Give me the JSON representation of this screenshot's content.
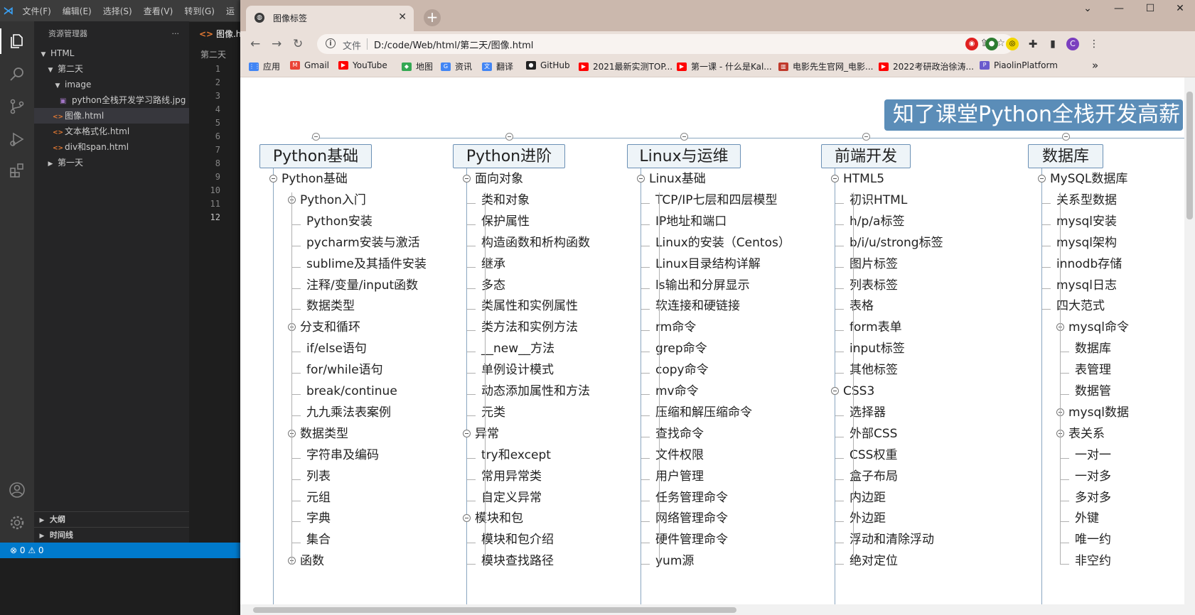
{
  "vscode": {
    "menu": [
      "文件(F)",
      "编辑(E)",
      "选择(S)",
      "查看(V)",
      "转到(G)",
      "运"
    ],
    "explorer_title": "资源管理器",
    "more": "···",
    "tree": [
      {
        "label": "HTML",
        "type": "folder-open",
        "indent": 0
      },
      {
        "label": "第二天",
        "type": "folder-open",
        "indent": 1
      },
      {
        "label": "image",
        "type": "folder-open",
        "indent": 2
      },
      {
        "label": "python全栈开发学习路线.jpg",
        "type": "image",
        "indent": 3
      },
      {
        "label": "图像.html",
        "type": "html",
        "indent": 2,
        "selected": true
      },
      {
        "label": "文本格式化.html",
        "type": "html",
        "indent": 2
      },
      {
        "label": "div和span.html",
        "type": "html",
        "indent": 2
      },
      {
        "label": "第一天",
        "type": "folder-closed",
        "indent": 1
      }
    ],
    "outline": "大纲",
    "timeline": "时间线",
    "tab": "图像.ht",
    "breadcrumb": "第二天",
    "line_numbers": [
      "1",
      "2",
      "3",
      "4",
      "5",
      "6",
      "7",
      "8",
      "9",
      "10",
      "11",
      "12"
    ],
    "current_line": "12",
    "status": "⊗ 0 ⚠ 0"
  },
  "browser": {
    "tab_title": "图像标签",
    "tab_close": "✕",
    "new_tab": "+",
    "window_controls": [
      "⌄",
      "—",
      "☐",
      "✕"
    ],
    "omnibox_label": "文件",
    "url": "D:/code/Web/html/第二天/图像.html",
    "profile_initial": "C",
    "bookmarks": [
      {
        "label": "应用",
        "icon": "apps-icon",
        "color": "#4285f4"
      },
      {
        "label": "Gmail",
        "icon": "gmail-icon",
        "color": "#ea4335"
      },
      {
        "label": "YouTube",
        "icon": "youtube-icon",
        "color": "#ff0000"
      },
      {
        "label": "地图",
        "icon": "maps-icon",
        "color": "#34a853"
      },
      {
        "label": "资讯",
        "icon": "news-icon",
        "color": "#4285f4"
      },
      {
        "label": "翻译",
        "icon": "translate-icon",
        "color": "#4285f4"
      },
      {
        "label": "GitHub",
        "icon": "github-icon",
        "color": "#222222"
      },
      {
        "label": "2021最新实测TOP...",
        "icon": "youtube-icon",
        "color": "#ff0000"
      },
      {
        "label": "第一课 - 什么是Kal...",
        "icon": "youtube-icon",
        "color": "#ff0000"
      },
      {
        "label": "电影先生官网_电影...",
        "icon": "film-icon",
        "color": "#c0392b"
      },
      {
        "label": "2022考研政治徐涛...",
        "icon": "youtube-icon",
        "color": "#ff0000"
      },
      {
        "label": "PiaolinPlatform",
        "icon": "piaolin-icon",
        "color": "#6a5acd"
      }
    ],
    "bookmarks_more": "»"
  },
  "mindmap": {
    "title": "知了课堂Python全栈开发高薪",
    "columns": [
      {
        "title": "Python基础",
        "groups": [
          {
            "label": "Python基础",
            "level": 0
          },
          {
            "label": "Python入门",
            "level": 1,
            "children": [
              "Python安装",
              "pycharm安装与激活",
              "sublime及其插件安装",
              "注释/变量/input函数",
              "数据类型"
            ]
          },
          {
            "label": "分支和循环",
            "level": 1,
            "children": [
              "if/else语句",
              "for/while语句",
              "break/continue",
              "九九乘法表案例"
            ]
          },
          {
            "label": "数据类型",
            "level": 1,
            "children": [
              "字符串及编码",
              "列表",
              "元组",
              "字典",
              "集合"
            ]
          },
          {
            "label": "函数",
            "level": 1,
            "children": []
          }
        ]
      },
      {
        "title": "Python进阶",
        "groups": [
          {
            "label": "面向对象",
            "level": 0,
            "children": [
              "类和对象",
              "保护属性",
              "构造函数和析构函数",
              "继承",
              "多态",
              "类属性和实例属性",
              "类方法和实例方法",
              "__new__方法",
              "单例设计模式",
              "动态添加属性和方法",
              "元类"
            ]
          },
          {
            "label": "异常",
            "level": 0,
            "children": [
              "try和except",
              "常用异常类",
              "自定义异常"
            ]
          },
          {
            "label": "模块和包",
            "level": 0,
            "children": [
              "模块和包介绍",
              "模块查找路径"
            ]
          }
        ]
      },
      {
        "title": "Linux与运维",
        "groups": [
          {
            "label": "Linux基础",
            "level": 0,
            "children": [
              "TCP/IP七层和四层模型",
              "IP地址和端口",
              "Linux的安装（Centos）",
              "Linux目录结构详解",
              "ls输出和分屏显示",
              "软连接和硬链接",
              "rm命令",
              "grep命令",
              "copy命令",
              "mv命令",
              "压缩和解压缩命令",
              "查找命令",
              "文件权限",
              "用户管理",
              "任务管理命令",
              "网络管理命令",
              "硬件管理命令",
              "yum源"
            ]
          }
        ]
      },
      {
        "title": "前端开发",
        "groups": [
          {
            "label": "HTML5",
            "level": 0,
            "children": [
              "初识HTML",
              "h/p/a标签",
              "b/i/u/strong标签",
              "图片标签",
              "列表标签",
              "表格",
              "form表单",
              "input标签",
              "其他标签"
            ]
          },
          {
            "label": "CSS3",
            "level": 0,
            "children": [
              "选择器",
              "外部CSS",
              "CSS权重",
              "盒子布局",
              "内边距",
              "外边距",
              "浮动和清除浮动",
              "绝对定位"
            ]
          }
        ]
      },
      {
        "title": "数据库",
        "groups": [
          {
            "label": "MySQL数据库",
            "level": 0,
            "children": [
              "关系型数据",
              "mysql安装",
              "mysql架构",
              "innodb存储",
              "mysql日志",
              "四大范式"
            ]
          },
          {
            "label": "mysql命令",
            "level": 1,
            "children": [
              "数据库",
              "表管理",
              "数据管"
            ]
          },
          {
            "label": "mysql数据",
            "level": 1,
            "children": []
          },
          {
            "label": "表关系",
            "level": 1,
            "children": [
              "一对一",
              "一对多",
              "多对多",
              "外键",
              "唯一约",
              "非空约"
            ]
          }
        ]
      }
    ]
  }
}
